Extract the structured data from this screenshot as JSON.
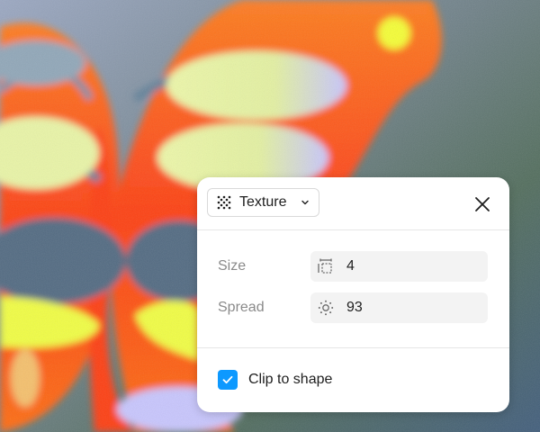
{
  "panel": {
    "effect_dropdown": {
      "label": "Texture",
      "icon": "texture-dots-icon"
    },
    "close_icon": "close-icon",
    "size": {
      "label": "Size",
      "value": "4",
      "icon": "size-corners-icon"
    },
    "spread": {
      "label": "Spread",
      "value": "93",
      "icon": "spread-sun-icon"
    },
    "clip": {
      "label": "Clip to shape",
      "checked": true
    }
  },
  "colors": {
    "accent": "#0d99ff",
    "panel_bg": "#ffffff",
    "field_bg": "#f3f3f3",
    "label_gray": "#8a8a8a",
    "butterfly_orange": "#ff4a10",
    "butterfly_yellow": "#e9f5a0"
  }
}
